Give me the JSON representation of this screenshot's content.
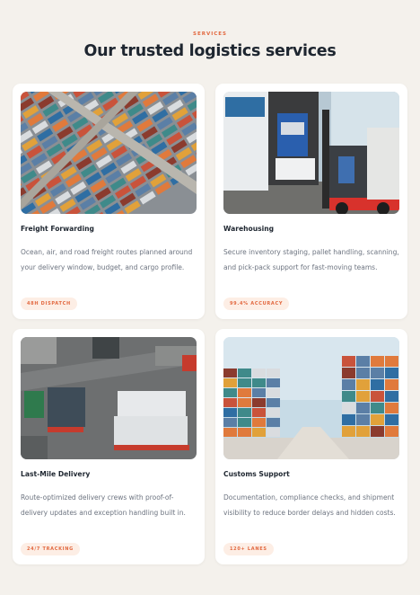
{
  "header": {
    "eyebrow": "SERVICES",
    "title": "Our trusted logistics services"
  },
  "cards": [
    {
      "title": "Freight Forwarding",
      "description": "Ocean, air, and road freight routes planned around your delivery window, budget, and cargo profile.",
      "badge": "48H DISPATCH",
      "image_subject": "aerial view of container port"
    },
    {
      "title": "Warehousing",
      "description": "Secure inventory staging, pallet handling, scanning, and pick-pack support for fast-moving teams.",
      "badge": "99.4% ACCURACY",
      "image_subject": "forklift loading truck"
    },
    {
      "title": "Last-Mile Delivery",
      "description": "Route-optimized delivery crews with proof-of-delivery updates and exception handling built in.",
      "badge": "24/7 TRACKING",
      "image_subject": "trucks carrying containers"
    },
    {
      "title": "Customs Support",
      "description": "Documentation, compliance checks, and shipment visibility to reduce border delays and hidden costs.",
      "badge": "120+ LANES",
      "image_subject": "stacked shipping containers yard"
    }
  ],
  "colors": {
    "background": "#f4f1ec",
    "card": "#ffffff",
    "accent": "#e2683f",
    "badge_bg": "#fdeee5",
    "heading": "#1e2630",
    "body_text": "#6d7480"
  }
}
